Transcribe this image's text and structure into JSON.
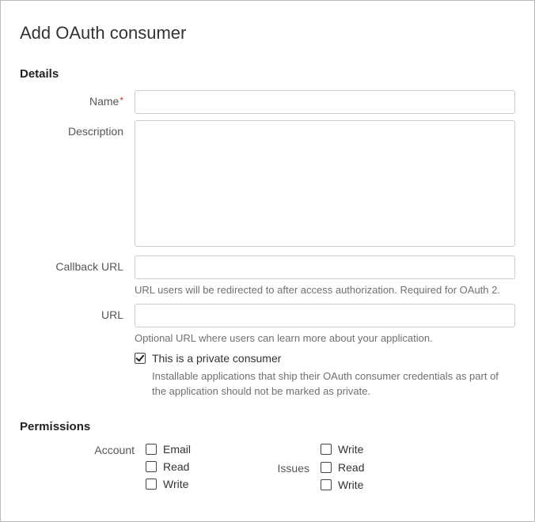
{
  "page": {
    "title": "Add OAuth consumer"
  },
  "sections": {
    "details": {
      "title": "Details"
    },
    "permissions": {
      "title": "Permissions"
    }
  },
  "fields": {
    "name": {
      "label": "Name",
      "value": ""
    },
    "description": {
      "label": "Description",
      "value": ""
    },
    "callback_url": {
      "label": "Callback URL",
      "value": "",
      "help": "URL users will be redirected to after access authorization. Required for OAuth 2."
    },
    "url": {
      "label": "URL",
      "value": "",
      "help": "Optional URL where users can learn more about your application."
    },
    "private_consumer": {
      "label": "This is a private consumer",
      "checked": true,
      "help": "Installable applications that ship their OAuth consumer credentials as part of the application should not be marked as private."
    }
  },
  "permissions": {
    "account": {
      "label": "Account",
      "options": [
        {
          "label": "Email",
          "checked": false
        },
        {
          "label": "Read",
          "checked": false
        },
        {
          "label": "Write",
          "checked": false
        }
      ]
    },
    "col2top": {
      "options": [
        {
          "label": "Write",
          "checked": false
        }
      ]
    },
    "issues": {
      "label": "Issues",
      "options": [
        {
          "label": "Read",
          "checked": false
        },
        {
          "label": "Write",
          "checked": false
        }
      ]
    }
  }
}
